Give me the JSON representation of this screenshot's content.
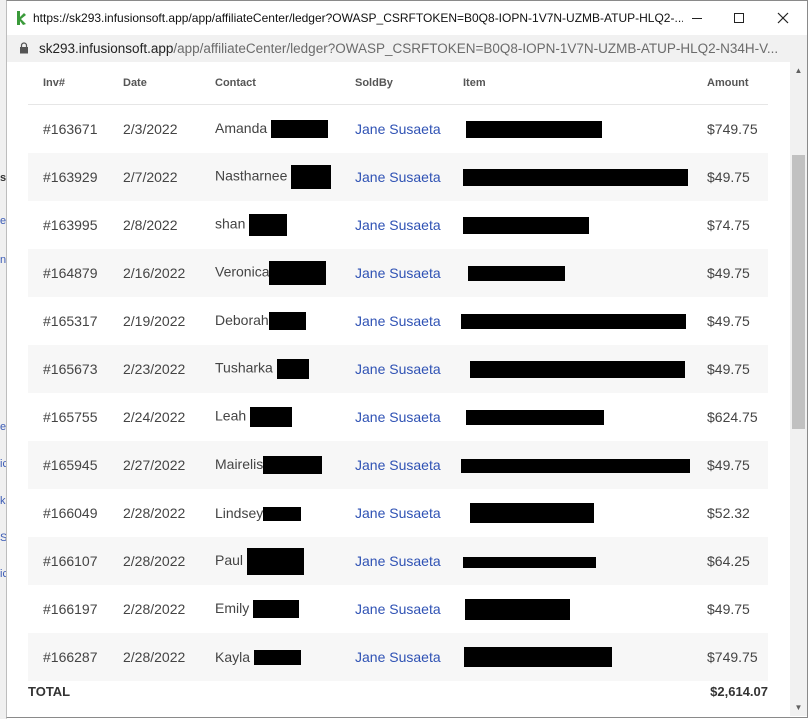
{
  "window": {
    "title": "https://sk293.infusionsoft.app/app/affiliateCenter/ledger?OWASP_CSRFTOKEN=B0Q8-IOPN-1V7N-UZMB-ATUP-HLQ2-...",
    "url_host": "sk293.infusionsoft.app",
    "url_path": "/app/affiliateCenter/ledger?OWASP_CSRFTOKEN=B0Q8-IOPN-1V7N-UZMB-ATUP-HLQ2-N34H-V..."
  },
  "table": {
    "headers": [
      "Inv#",
      "Date",
      "Contact",
      "SoldBy",
      "Item",
      "Amount"
    ],
    "rows": [
      {
        "inv": "#163671",
        "date": "2/3/2022",
        "contact": "Amanda",
        "soldby": "Jane Susaeta",
        "amount": "$749.75"
      },
      {
        "inv": "#163929",
        "date": "2/7/2022",
        "contact": "Nastharnee",
        "soldby": "Jane Susaeta",
        "amount": "$49.75"
      },
      {
        "inv": "#163995",
        "date": "2/8/2022",
        "contact": "shan",
        "soldby": "Jane Susaeta",
        "amount": "$74.75"
      },
      {
        "inv": "#164879",
        "date": "2/16/2022",
        "contact": "Veronica",
        "soldby": "Jane Susaeta",
        "amount": "$49.75"
      },
      {
        "inv": "#165317",
        "date": "2/19/2022",
        "contact": "Deborah",
        "soldby": "Jane Susaeta",
        "amount": "$49.75"
      },
      {
        "inv": "#165673",
        "date": "2/23/2022",
        "contact": "Tusharka",
        "soldby": "Jane Susaeta",
        "amount": "$49.75"
      },
      {
        "inv": "#165755",
        "date": "2/24/2022",
        "contact": "Leah",
        "soldby": "Jane Susaeta",
        "amount": "$624.75"
      },
      {
        "inv": "#165945",
        "date": "2/27/2022",
        "contact": "Mairelis",
        "soldby": "Jane Susaeta",
        "amount": "$49.75"
      },
      {
        "inv": "#166049",
        "date": "2/28/2022",
        "contact": "Lindsey",
        "soldby": "Jane Susaeta",
        "amount": "$52.32"
      },
      {
        "inv": "#166107",
        "date": "2/28/2022",
        "contact": "Paul",
        "soldby": "Jane Susaeta",
        "amount": "$64.25"
      },
      {
        "inv": "#166197",
        "date": "2/28/2022",
        "contact": "Emily",
        "soldby": "Jane Susaeta",
        "amount": "$49.75"
      },
      {
        "inv": "#166287",
        "date": "2/28/2022",
        "contact": "Kayla",
        "soldby": "Jane Susaeta",
        "amount": "$749.75"
      }
    ]
  },
  "total": {
    "label": "TOTAL",
    "value": "$2,614.07"
  },
  "behind_page": {
    "fragments": [
      "s",
      "e",
      "n",
      "er",
      "ic",
      "k",
      "S",
      "ic"
    ]
  },
  "colors": {
    "link": "#2f52b4",
    "favicon": "#3a9a3a",
    "row_alt": "#f7f7f7"
  }
}
